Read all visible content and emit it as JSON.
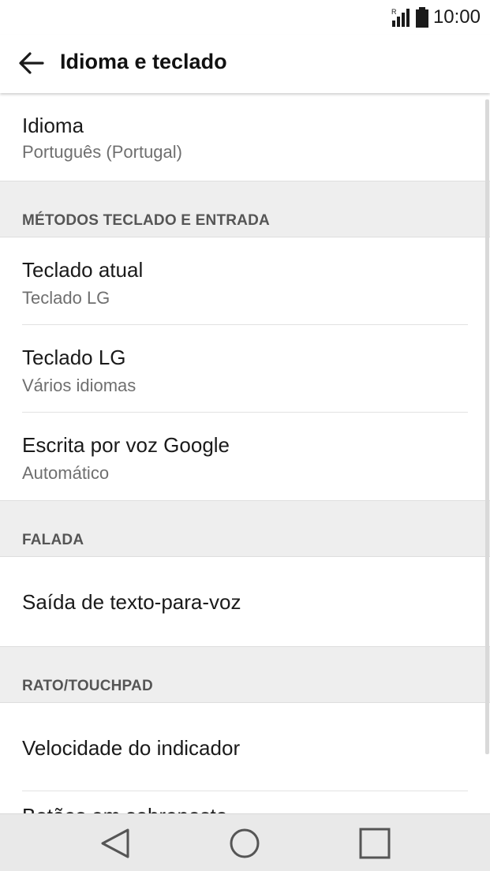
{
  "status": {
    "time": "10:00",
    "icons": [
      "signal-icon",
      "battery-icon"
    ],
    "signal_badge": "R"
  },
  "appbar": {
    "title": "Idioma e teclado",
    "back_icon": "back-arrow-icon"
  },
  "language": {
    "title": "Idioma",
    "value": "Português (Portugal)"
  },
  "section_input": {
    "header": "MÉTODOS TECLADO E ENTRADA",
    "items": [
      {
        "title": "Teclado atual",
        "subtitle": "Teclado LG"
      },
      {
        "title": "Teclado LG",
        "subtitle": "Vários idiomas"
      },
      {
        "title": "Escrita por voz Google",
        "subtitle": "Automático"
      }
    ]
  },
  "section_speech": {
    "header": "FALADA",
    "items": [
      {
        "title": "Saída de texto-para-voz"
      }
    ]
  },
  "section_mouse": {
    "header": "RATO/TOUCHPAD",
    "items": [
      {
        "title": "Velocidade do indicador"
      },
      {
        "title": "Botões em sobreposto"
      }
    ]
  },
  "navbar": {
    "icons": [
      "back-triangle-icon",
      "home-circle-icon",
      "recents-square-icon"
    ]
  },
  "colors": {
    "background": "#ffffff",
    "section_bg": "#eeeeee",
    "navbar_bg": "#e9e9e9",
    "subtitle": "#6f6f6f"
  }
}
